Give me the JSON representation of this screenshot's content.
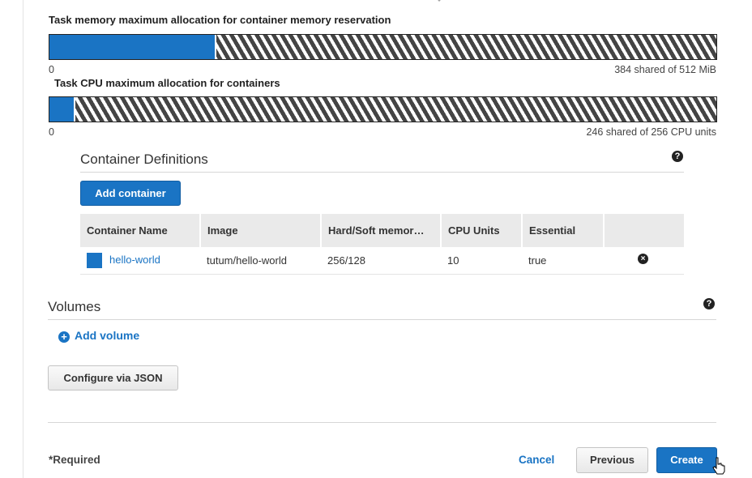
{
  "memory_allocation": {
    "title": "Task memory maximum allocation for container memory reservation",
    "min_label": "0",
    "summary": "384 shared of 512 MiB",
    "used": 128,
    "total": 512
  },
  "cpu_allocation": {
    "title": "Task CPU maximum allocation for containers",
    "min_label": "0",
    "summary": "246 shared of 256 CPU units",
    "used": 10,
    "total": 256
  },
  "container_definitions": {
    "title": "Container Definitions",
    "help_icon": "question-circle-icon",
    "add_button": "Add container",
    "columns": [
      "Container Name",
      "Image",
      "Hard/Soft memor…",
      "CPU Units",
      "Essential",
      ""
    ],
    "rows": [
      {
        "name": "hello-world",
        "image": "tutum/hello-world",
        "memory": "256/128",
        "cpu": "10",
        "essential": "true",
        "remove_icon": "remove-circle-icon"
      }
    ]
  },
  "volumes": {
    "title": "Volumes",
    "help_icon": "question-circle-icon",
    "add_label": "Add volume"
  },
  "configure_json_label": "Configure via JSON",
  "footer": {
    "required_label": "*Required",
    "cancel_label": "Cancel",
    "previous_label": "Previous",
    "create_label": "Create"
  },
  "colors": {
    "accent": "#1a74c4",
    "bar_stripe": "#444444"
  }
}
